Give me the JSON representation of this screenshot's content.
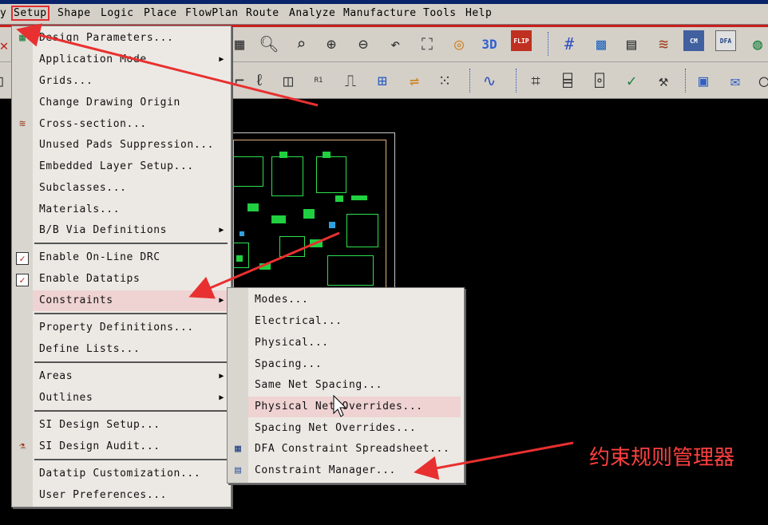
{
  "menubar": {
    "items": [
      {
        "label": "y",
        "key": "y"
      },
      {
        "label": "Setup",
        "key": "setup",
        "active": true
      },
      {
        "label": "Shape",
        "key": "shape"
      },
      {
        "label": "Logic",
        "key": "logic"
      },
      {
        "label": "Place",
        "key": "place"
      },
      {
        "label": "FlowPlan",
        "key": "flowplan"
      },
      {
        "label": "Route",
        "key": "route"
      },
      {
        "label": "Analyze",
        "key": "analyze"
      },
      {
        "label": "Manufacture",
        "key": "manufacture"
      },
      {
        "label": "Tools",
        "key": "tools"
      },
      {
        "label": "Help",
        "key": "help"
      }
    ]
  },
  "setup_menu": {
    "items": [
      {
        "label": "Design Parameters...",
        "icon": "design-parameters-icon"
      },
      {
        "label": "Application Mode",
        "submenu": true
      },
      {
        "label": "Grids..."
      },
      {
        "label": "Change Drawing Origin"
      },
      {
        "label": "Cross-section...",
        "icon": "cross-section-icon"
      },
      {
        "label": "Unused Pads Suppression..."
      },
      {
        "label": "Embedded Layer Setup..."
      },
      {
        "label": "Subclasses..."
      },
      {
        "label": "Materials..."
      },
      {
        "label": "B/B Via Definitions",
        "submenu": true
      },
      {
        "label": "Enable On-Line DRC",
        "checked": true
      },
      {
        "label": "Enable Datatips",
        "checked": true
      },
      {
        "label": "Constraints",
        "submenu": true,
        "highlighted": true
      },
      {
        "label": "Property Definitions..."
      },
      {
        "label": "Define Lists..."
      },
      {
        "label": "Areas",
        "submenu": true
      },
      {
        "label": "Outlines",
        "submenu": true
      },
      {
        "label": "SI Design Setup..."
      },
      {
        "label": "SI Design Audit...",
        "icon": "si-audit-icon"
      },
      {
        "label": "Datatip Customization..."
      },
      {
        "label": "User Preferences..."
      }
    ]
  },
  "constraints_submenu": {
    "items": [
      {
        "label": "Modes..."
      },
      {
        "label": "Electrical..."
      },
      {
        "label": "Physical..."
      },
      {
        "label": "Spacing..."
      },
      {
        "label": "Same Net Spacing..."
      },
      {
        "label": "Physical Net Overrides...",
        "highlighted": true
      },
      {
        "label": "Spacing Net Overrides..."
      },
      {
        "label": "DFA Constraint Spreadsheet...",
        "icon": "spreadsheet-icon"
      },
      {
        "label": "Constraint Manager...",
        "icon": "constraint-manager-icon"
      }
    ]
  },
  "toolbar": {
    "labels": {
      "three_d": "3D",
      "flip": "FLIP",
      "cm": "CM",
      "dfa": "DFA"
    }
  },
  "annotation": {
    "text": "约束规则管理器"
  },
  "colors": {
    "menu_bg": "#ece9e4",
    "highlight": "#efd2d2",
    "accent_red": "#e03030",
    "canvas": "#000000",
    "pcb_green": "#2ee04e"
  }
}
